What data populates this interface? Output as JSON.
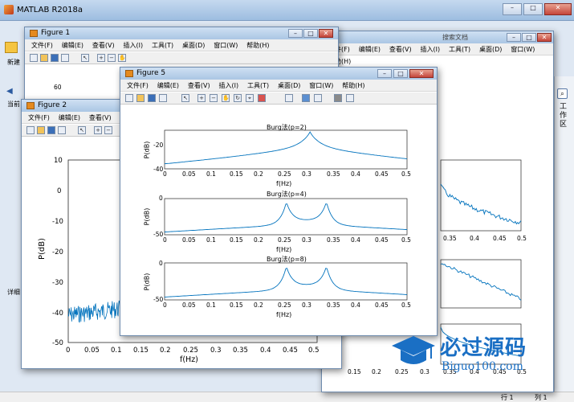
{
  "matlab": {
    "title": "MATLAB R2018a",
    "new_label": "新建",
    "current_label": "当前",
    "detail_label": "详细",
    "side_tab": "工作区",
    "search_placeholder": "搜索文档",
    "status_row": "行 1",
    "status_col": "列 1"
  },
  "menus": {
    "file": "文件(F)",
    "edit": "编辑(E)",
    "view": "查看(V)",
    "insert": "插入(I)",
    "tools": "工具(T)",
    "desktop": "桌面(D)",
    "window": "窗口(W)",
    "help": "帮助(H)"
  },
  "figure1": {
    "title": "Figure 1",
    "ytick": "60"
  },
  "figure2": {
    "title": "Figure 2",
    "ylabel": "P(dB)",
    "xlabel": "f(Hz)",
    "yticks": [
      "10",
      "0",
      "-10",
      "-20",
      "-30",
      "-40",
      "-50"
    ],
    "xticks": [
      "0",
      "0.05",
      "0.1",
      "0.15",
      "0.2",
      "0.25",
      "0.3",
      "0.35",
      "0.4",
      "0.45",
      "0.5"
    ]
  },
  "figure3": {
    "xticks": [
      "0.35",
      "0.4",
      "0.45",
      "0.5"
    ],
    "bottom_xticks": [
      "0.15",
      "0.2",
      "0.25",
      "0.3",
      "0.35",
      "0.4",
      "0.45",
      "0.5"
    ]
  },
  "figure5": {
    "title": "Figure 5",
    "ylabel": "P(dB)",
    "xlabel": "f(Hz)",
    "xticks": [
      "0",
      "0.05",
      "0.1",
      "0.15",
      "0.2",
      "0.25",
      "0.3",
      "0.35",
      "0.4",
      "0.45",
      "0.5"
    ],
    "subplots": [
      {
        "title": "Burg法(p=2)",
        "yticks": [
          "-20",
          "-40"
        ]
      },
      {
        "title": "Burg法(p=4)",
        "yticks": [
          "0",
          "-50"
        ]
      },
      {
        "title": "Burg法(p=8)",
        "yticks": [
          "0",
          "-50"
        ]
      }
    ]
  },
  "watermark": {
    "brand": "必过源码",
    "url": "Biguo100.com"
  },
  "colors": {
    "line": "#0072bd",
    "titlebar": "#bcd3ec",
    "desktop": "#6a8fb5"
  }
}
